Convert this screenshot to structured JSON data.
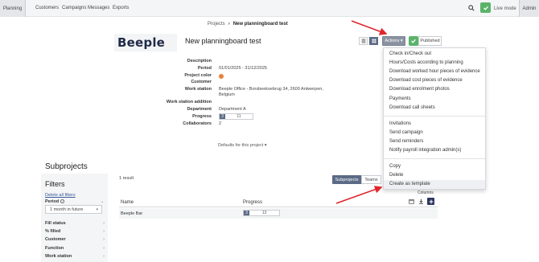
{
  "nav": {
    "planning": "Planning",
    "items": [
      "Customers",
      "Campaigns",
      "Messages",
      "Exports"
    ],
    "live_mode": "Live mode",
    "admin": "Admin"
  },
  "breadcrumb": {
    "parent": "Projects",
    "separator": "›",
    "current": "New planningboard test"
  },
  "project": {
    "logo_text": "Beeple",
    "title": "New planningboard test",
    "actions_label": "Actions ▾",
    "published_label": "Published",
    "color": "#e8823a",
    "details": {
      "description_label": "Description",
      "period_label": "Period",
      "period_value": "01/01/2025 - 31/12/2025",
      "color_label": "Project color",
      "customer_label": "Customer",
      "workstation_label": "Work station",
      "workstation_line1": "Beeple Office - Borsbeeksebrug 34, 2600 Antwerpen,",
      "workstation_line2": "Belgium",
      "ws_addition_label": "Work station addition",
      "department_label": "Department",
      "department_value": "Department A",
      "progress_label": "Progress",
      "progress_done": "3",
      "progress_total": "11",
      "collaborators_label": "Collaborators",
      "collaborators_value": "2"
    },
    "defaults_link": "Defaults for this project ▾"
  },
  "actions_menu": {
    "group1": [
      "Check in/Check out",
      "Hours/Costs according to planning",
      "Download worked hour pieces of evidence",
      "Download cost pieces of evidence",
      "Download enrolment photos",
      "Payments",
      "Download call sheets"
    ],
    "group2": [
      "Invitations",
      "Send campaign",
      "Send reminders",
      "Notify payroll integration admin(s)"
    ],
    "group3": [
      "Copy",
      "Delete",
      "Create as template"
    ]
  },
  "subprojects": {
    "title": "Subprojects",
    "result_count": "1 result",
    "tab_subprojects": "Subprojects",
    "tab_teams": "Teams",
    "columns_label": "Columns",
    "table": {
      "headers": [
        "Name",
        "Progress"
      ],
      "rows": [
        {
          "name": "Beeple Bar",
          "progress_done": "3",
          "progress_total": "13"
        }
      ]
    }
  },
  "filters": {
    "title": "Filters",
    "delete_all": "Delete all filters",
    "period_label": "Period",
    "period_value": "1 month in future",
    "rows": [
      "Fill status",
      "% filled",
      "Customer",
      "Function",
      "Work station"
    ]
  },
  "colors": {
    "accent_green": "#5bb36a",
    "progress_blue": "#5b6a86",
    "arrow_red": "#e0262b"
  }
}
